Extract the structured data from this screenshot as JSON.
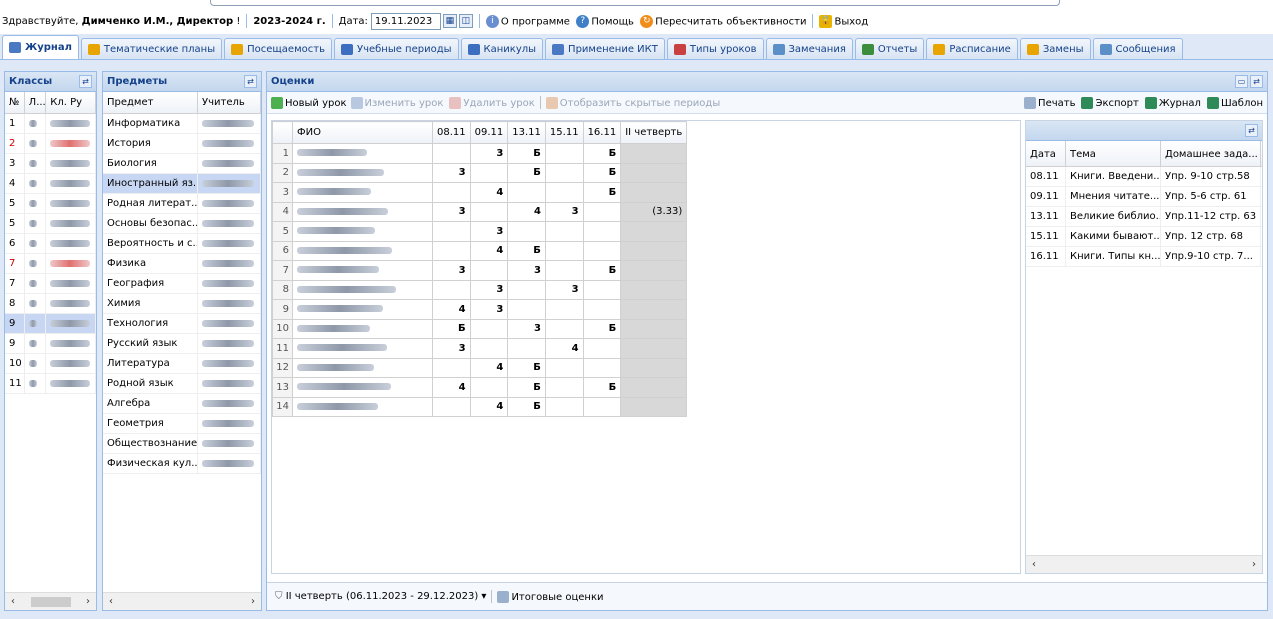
{
  "header": {
    "greeting_prefix": "Здравствуйте,",
    "user": "Димченко И.М., Директор",
    "excl": "!",
    "year": "2023-2024 г.",
    "date_label": "Дата:",
    "date_value": "19.11.2023",
    "about": "О программе",
    "help": "Помощь",
    "recalc": "Пересчитать объективности",
    "exit": "Выход"
  },
  "tabs": [
    "Журнал",
    "Тематические планы",
    "Посещаемость",
    "Учебные периоды",
    "Каникулы",
    "Применение ИКТ",
    "Типы уроков",
    "Замечания",
    "Отчеты",
    "Расписание",
    "Замены",
    "Сообщения"
  ],
  "classes": {
    "title": "Классы",
    "cols": [
      "№",
      "Л...",
      "Кл. Ру"
    ],
    "rows": [
      "1",
      "2",
      "3",
      "4",
      "5",
      "5",
      "6",
      "7",
      "7",
      "8",
      "9",
      "9",
      "10",
      "11"
    ]
  },
  "subjects": {
    "title": "Предметы",
    "cols": [
      "Предмет",
      "Учитель"
    ],
    "rows": [
      "Информатика",
      "История",
      "Биология",
      "Иностранный яз...",
      "Родная литерат...",
      "Основы безопас...",
      "Вероятность и с...",
      "Физика",
      "География",
      "Химия",
      "Технология",
      "Русский язык",
      "Литература",
      "Родной язык",
      "Алгебра",
      "Геометрия",
      "Обществознание",
      "Физическая кул..."
    ]
  },
  "grades": {
    "title": "Оценки",
    "toolbar": {
      "new_lesson": "Новый урок",
      "edit_lesson": "Изменить урок",
      "delete_lesson": "Удалить урок",
      "show_hidden": "Отобразить скрытые периоды",
      "print": "Печать",
      "export": "Экспорт",
      "journal": "Журнал",
      "template": "Шаблон"
    },
    "cols": [
      "ФИО",
      "08.11",
      "09.11",
      "13.11",
      "15.11",
      "16.11",
      "II четверть"
    ],
    "rows": [
      {
        "n": "1",
        "g": [
          "",
          "3",
          "Б",
          "",
          "Б"
        ],
        "q": ""
      },
      {
        "n": "2",
        "g": [
          "3",
          "",
          "Б",
          "",
          "Б"
        ],
        "q": ""
      },
      {
        "n": "3",
        "g": [
          "",
          "4",
          "",
          "",
          "Б"
        ],
        "q": ""
      },
      {
        "n": "4",
        "g": [
          "3",
          "",
          "4",
          "3",
          ""
        ],
        "q": "(3.33)"
      },
      {
        "n": "5",
        "g": [
          "",
          "3",
          "",
          "",
          ""
        ],
        "q": ""
      },
      {
        "n": "6",
        "g": [
          "",
          "4",
          "Б",
          "",
          ""
        ],
        "q": ""
      },
      {
        "n": "7",
        "g": [
          "3",
          "",
          "3",
          "",
          "Б"
        ],
        "q": ""
      },
      {
        "n": "8",
        "g": [
          "",
          "3",
          "",
          "3",
          ""
        ],
        "q": ""
      },
      {
        "n": "9",
        "g": [
          "4",
          "3",
          "",
          "",
          ""
        ],
        "q": ""
      },
      {
        "n": "10",
        "g": [
          "Б",
          "",
          "3",
          "",
          "Б"
        ],
        "q": ""
      },
      {
        "n": "11",
        "g": [
          "3",
          "",
          "",
          "4",
          ""
        ],
        "q": ""
      },
      {
        "n": "12",
        "g": [
          "",
          "4",
          "Б",
          "",
          ""
        ],
        "q": ""
      },
      {
        "n": "13",
        "g": [
          "4",
          "",
          "Б",
          "",
          "Б"
        ],
        "q": ""
      },
      {
        "n": "14",
        "g": [
          "",
          "4",
          "Б",
          "",
          ""
        ],
        "q": ""
      }
    ],
    "period": "II четверть (06.11.2023 - 29.12.2023)",
    "final": "Итоговые оценки"
  },
  "lessons": {
    "cols": [
      "Дата",
      "Тема",
      "Домашнее зада..."
    ],
    "rows": [
      [
        "08.11",
        "Книги. Введени...",
        "Упр. 9-10 стр.58"
      ],
      [
        "09.11",
        "Мнения читате...",
        "Упр. 5-6 стр. 61"
      ],
      [
        "13.11",
        "Великие библио...",
        "Упр.11-12 стр. 63"
      ],
      [
        "15.11",
        "Какими бывают...",
        "Упр. 12 стр. 68"
      ],
      [
        "16.11",
        "Книги. Типы кн...",
        "Упр.9-10 стр. 7..."
      ]
    ]
  },
  "colors": {
    "accent": "#15428b",
    "border": "#99bbe8",
    "selected": "#c7d6f3"
  }
}
